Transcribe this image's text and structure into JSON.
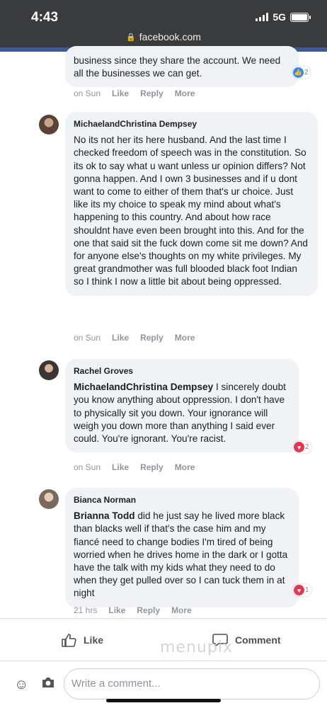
{
  "status_bar": {
    "time": "4:43",
    "network": "5G",
    "url": "facebook.com"
  },
  "comments": [
    {
      "author": "",
      "text": "business since they share the account. We need all the businesses we can get.",
      "timestamp": "on Sun",
      "like_label": "Like",
      "reply_label": "Reply",
      "more_label": "More",
      "reaction_icon": "like-icon",
      "reaction_count": "2"
    },
    {
      "author": "MichaelandChristina Dempsey",
      "text": "No its not her its here husband. And the last time I checked freedom of speech was in the constitution. So its ok to say what u want unless ur opinion differs? Not gonna happen. And I own 3 businesses and if u dont want to come to either of them that's ur choice. Just like its my choice to speak my mind about what's happening to this country. And about how race shouldnt have even been brought into this. And for the one that said sit the fuck down come sit me down? And for anyone else's thoughts on my white privileges. My great grandmother was full blooded black foot Indian so I think I now a little bit about being oppressed.",
      "timestamp": "on Sun",
      "like_label": "Like",
      "reply_label": "Reply",
      "more_label": "More"
    },
    {
      "author": "Rachel Groves",
      "mention": "MichaelandChristina Dempsey",
      "text": " I sincerely doubt you know anything about oppression. I don't have to physically sit you down. Your ignorance will weigh you down more than anything I said ever could. You're ignorant. You're racist.",
      "timestamp": "on Sun",
      "like_label": "Like",
      "reply_label": "Reply",
      "more_label": "More",
      "reaction_icon": "heart-icon",
      "reaction_count": "2"
    },
    {
      "author": "Bianca Norman",
      "mention": "Brianna Todd",
      "text": " did he just say he lived more black than blacks well if that's the case him and my fiancé need to change bodies I'm tired of being worried when he drives home in the dark or I gotta have the talk with my kids what they need to do when they get pulled over so I can tuck them in at night",
      "timestamp": "21 hrs",
      "like_label": "Like",
      "reply_label": "Reply",
      "more_label": "More",
      "reaction_icon": "heart-icon",
      "reaction_count": "1"
    }
  ],
  "actions": {
    "like_label": "Like",
    "comment_label": "Comment"
  },
  "watermark": "menupix",
  "composer": {
    "placeholder": "Write a comment..."
  },
  "colors": {
    "accent": "#3b5998",
    "like": "#2d88ff",
    "heart": "#e8344e",
    "bubble": "#f0f2f5",
    "meta": "#90949c"
  }
}
